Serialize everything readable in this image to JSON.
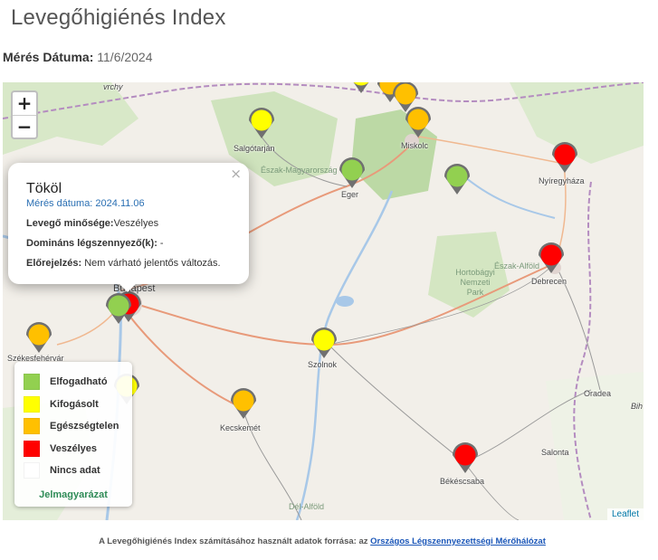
{
  "page": {
    "title": "Levegőhigiénés Index",
    "date_label": "Mérés Dátuma:",
    "date_value": "11/6/2024"
  },
  "map": {
    "zoom_in": "+",
    "zoom_out": "−",
    "attribution": "Leaflet",
    "cities": {
      "salgotarjan": "Salgótarján",
      "miskolc": "Miskolc",
      "eger": "Eger",
      "nyiregyhaza": "Nyíregyháza",
      "debrecen": "Debrecen",
      "budapest": "Budapest",
      "szolnok": "Szolnok",
      "kecskemet": "Kecskemét",
      "bekescsaba": "Békéscsaba",
      "oradea": "Oradea",
      "salonta": "Salonta",
      "szekesfehervar": "Székesfehérvár",
      "vrchy": "vrchy",
      "bih": "Bih"
    },
    "regions": {
      "eszak_magyarorszag": "Észak-Magyarország",
      "eszak_alfold": "Észak-Alföld",
      "hortobagy": "Hortobágyi\nNemzeti\nPark",
      "del_alfold": "Dél-Alföld"
    }
  },
  "colors": {
    "elfogadhato": "#92d050",
    "kifogasolt": "#ffff00",
    "egeszsegtelen": "#ffc000",
    "veszelyes": "#ff0000",
    "nincs_adat": "#ffffff"
  },
  "stations": [
    {
      "level": "kifogasolt"
    },
    {
      "level": "egeszsegtelen"
    },
    {
      "level": "egeszsegtelen"
    },
    {
      "level": "kifogasolt"
    },
    {
      "level": "egeszsegtelen"
    },
    {
      "level": "elfogadhato"
    },
    {
      "level": "elfogadhato"
    },
    {
      "level": "veszelyes"
    },
    {
      "level": "veszelyes"
    },
    {
      "level": "veszelyes"
    },
    {
      "level": "elfogadhato"
    },
    {
      "level": "egeszsegtelen"
    },
    {
      "level": "kifogasolt"
    },
    {
      "level": "egeszsegtelen"
    },
    {
      "level": "veszelyes"
    },
    {
      "level": "kifogasolt"
    }
  ],
  "popup": {
    "close": "×",
    "station": "Tököl",
    "date_line": "Mérés dátuma: 2024.11.06",
    "quality_label": "Levegő minősége:",
    "quality_value": "Veszélyes",
    "pollutant_label": "Domináns légszennyező(k):",
    "pollutant_value": "-",
    "forecast_label": "Előrejelzés:",
    "forecast_value": "Nem várható jelentős változás."
  },
  "legend": {
    "items": [
      {
        "label": "Elfogadható",
        "color": "#92d050"
      },
      {
        "label": "Kifogásolt",
        "color": "#ffff00"
      },
      {
        "label": "Egészségtelen",
        "color": "#ffc000"
      },
      {
        "label": "Veszélyes",
        "color": "#ff0000"
      },
      {
        "label": "Nincs adat",
        "color": "#ffffff"
      }
    ],
    "link": "Jelmagyarázat"
  },
  "footer": {
    "text": "A Levegőhigiénés Index számításához használt adatok forrása: az",
    "link": "Országos Légszennyezettségi Mérőhálózat"
  }
}
